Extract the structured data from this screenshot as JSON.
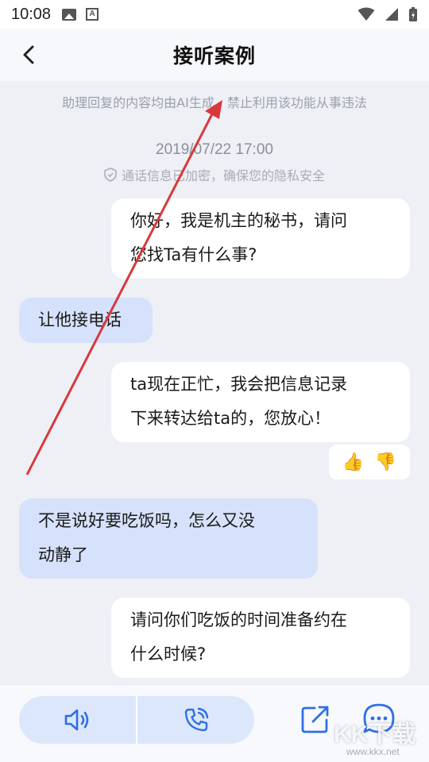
{
  "status_bar": {
    "time": "10:08"
  },
  "header": {
    "title": "接听案例"
  },
  "notice": {
    "text": "助理回复的内容均由AI生成，禁止利用该功能从事违法"
  },
  "call": {
    "timestamp": "2019/07/22 17:00",
    "privacy_text": "通话信息已加密，确保您的隐私安全"
  },
  "messages": [
    {
      "side": "right",
      "lines": [
        "你好，我是机主的秘书，请问",
        "您找Ta有什么事?"
      ]
    },
    {
      "side": "left",
      "lines": [
        "让他接电话"
      ]
    },
    {
      "side": "right",
      "lines": [
        "ta现在正忙，我会把信息记录",
        "下来转达给ta的，您放心！"
      ]
    },
    {
      "side": "left",
      "lines": [
        "不是说好要吃饭吗，怎么又没",
        "动静了"
      ]
    },
    {
      "side": "right",
      "lines": [
        "请问你们吃饭的时间准备约在",
        "什么时候?"
      ]
    }
  ],
  "feedback": {
    "like_icon": "👍",
    "dislike_icon": "👎"
  },
  "bottom_bar": {
    "speaker_icon": "speaker-icon",
    "phone_icon": "phone-call-icon",
    "share_icon": "share-icon",
    "chat_icon": "chat-icon"
  },
  "watermark": {
    "text": "KK下载",
    "sub": "www.kkx.net"
  },
  "colors": {
    "background": "#eef0f6",
    "left_bubble": "#d6e2fb",
    "right_bubble": "#ffffff",
    "accent": "#2f6fe4",
    "annotation_arrow": "#d9383a"
  }
}
